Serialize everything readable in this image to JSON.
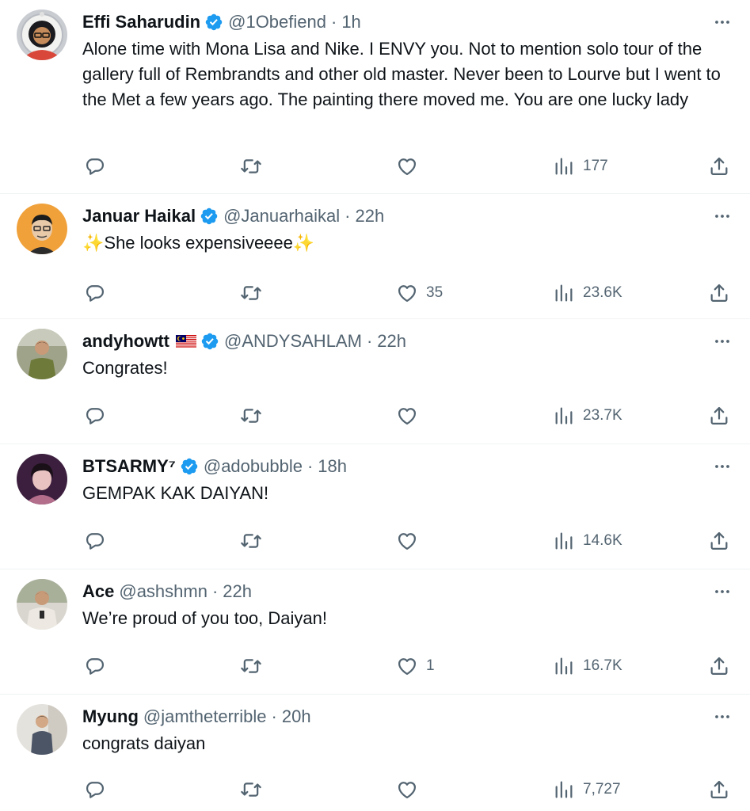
{
  "tweets": [
    {
      "name": "Effi Saharudin",
      "verified": true,
      "flag": "",
      "handle": "@1Obefiend",
      "time": "1h",
      "text": "Alone time with Mona Lisa and Nike. I ENVY you. Not to mention solo tour of the gallery full of Rembrandts and other old master. Never been to Lourve but I went to the Met a few years ago. The painting there moved me. You are one lucky lady",
      "replies": "",
      "retweets": "",
      "likes": "",
      "views": "177",
      "avatar": "astronaut-avatar"
    },
    {
      "name": "Januar Haikal",
      "verified": true,
      "flag": "",
      "handle": "@Januarhaikal",
      "time": "22h",
      "text": "✨She looks expensiveeee✨",
      "replies": "",
      "retweets": "",
      "likes": "35",
      "views": "23.6K",
      "avatar": "cartoon-man-avatar"
    },
    {
      "name": "andyhowtt",
      "verified": true,
      "flag": "malaysia-flag",
      "handle": "@ANDYSAHLAM",
      "time": "22h",
      "text": "Congrates!",
      "replies": "",
      "retweets": "",
      "likes": "",
      "views": "23.7K",
      "avatar": "photo-avatar"
    },
    {
      "name": "BTSARMY⁷",
      "verified": true,
      "flag": "",
      "handle": "@adobubble",
      "time": "18h",
      "text": "GEMPAK KAK DAIYAN!",
      "replies": "",
      "retweets": "",
      "likes": "",
      "views": "14.6K",
      "avatar": "photo-avatar"
    },
    {
      "name": "Ace",
      "verified": false,
      "flag": "",
      "handle": "@ashshmn",
      "time": "22h",
      "text": "We’re proud of you too, Daiyan!",
      "replies": "",
      "retweets": "",
      "likes": "1",
      "views": "16.7K",
      "avatar": "photo-avatar"
    },
    {
      "name": "Myung",
      "verified": false,
      "flag": "",
      "handle": "@jamtheterrible",
      "time": "20h",
      "text": "congrats daiyan",
      "replies": "",
      "retweets": "",
      "likes": "",
      "views": "7,727",
      "avatar": "photo-avatar"
    }
  ],
  "colors": {
    "text": "#0f1419",
    "muted": "#536471",
    "verified": "#1d9bf0",
    "divider": "#eff3f4"
  },
  "icons": {
    "more": "more-dots-icon",
    "reply": "reply-icon",
    "retweet": "retweet-icon",
    "like": "heart-icon",
    "views": "views-icon",
    "share": "share-icon",
    "verified": "verified-badge-icon"
  }
}
